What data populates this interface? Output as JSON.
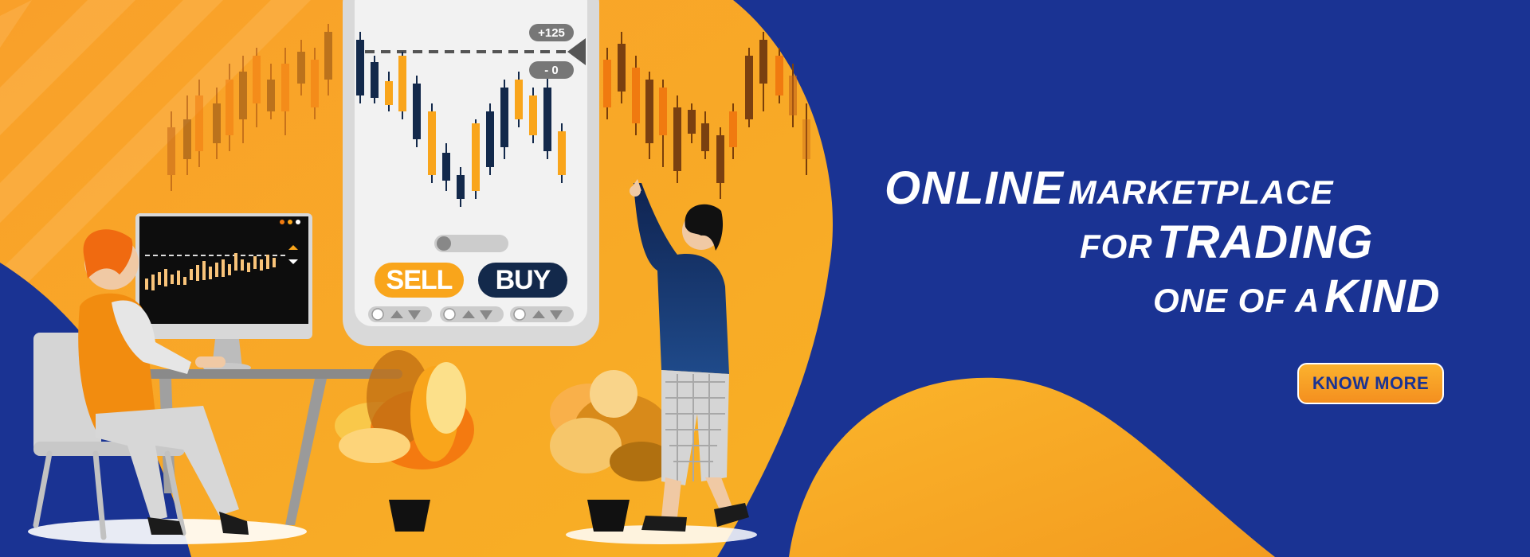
{
  "headline": {
    "line1_big": "ONLINE",
    "line1_small": "MARKETPLACE",
    "line2_small": "FOR",
    "line2_big": "TRADING",
    "line3_small": "ONE OF A",
    "line3_big": "KIND"
  },
  "cta": {
    "label": "KNOW MORE"
  },
  "phone": {
    "sell_label": "SELL",
    "buy_label": "BUY",
    "price_up": "+125",
    "price_down": "- 0"
  },
  "colors": {
    "navy": "#1a3393",
    "orange": "#f9a51b",
    "dark_orange": "#f48f1f",
    "candle_dark": "#13294b"
  }
}
